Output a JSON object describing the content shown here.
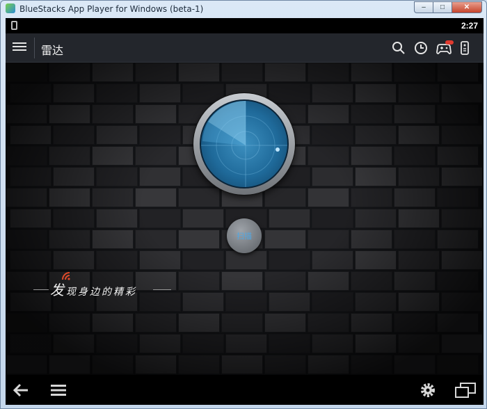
{
  "window": {
    "title": "BlueStacks App Player for Windows (beta-1)",
    "controls": {
      "minimize": "–",
      "maximize": "□",
      "close": "✕"
    }
  },
  "status_bar": {
    "time": "2:27",
    "left_icon": "vibrate-icon"
  },
  "action_bar": {
    "menu_icon": "hamburger-menu-icon",
    "title": "雷达",
    "actions": [
      {
        "name": "search",
        "icon": "search-icon"
      },
      {
        "name": "history",
        "icon": "clock-icon"
      },
      {
        "name": "games",
        "icon": "gamepad-icon",
        "badge": "NEW"
      },
      {
        "name": "remote",
        "icon": "remote-icon"
      }
    ]
  },
  "main": {
    "scan_button_label": "扫描",
    "slogan_big": "发",
    "slogan_rest": "现身边的精彩",
    "accent_color": "#4fa7e4",
    "radar_color": "#1f6a9a"
  },
  "nav_bar": {
    "back_icon": "back-arrow-icon",
    "menu_icon": "menu-icon",
    "settings_icon": "gear-icon",
    "window_icon": "multi-window-icon"
  }
}
